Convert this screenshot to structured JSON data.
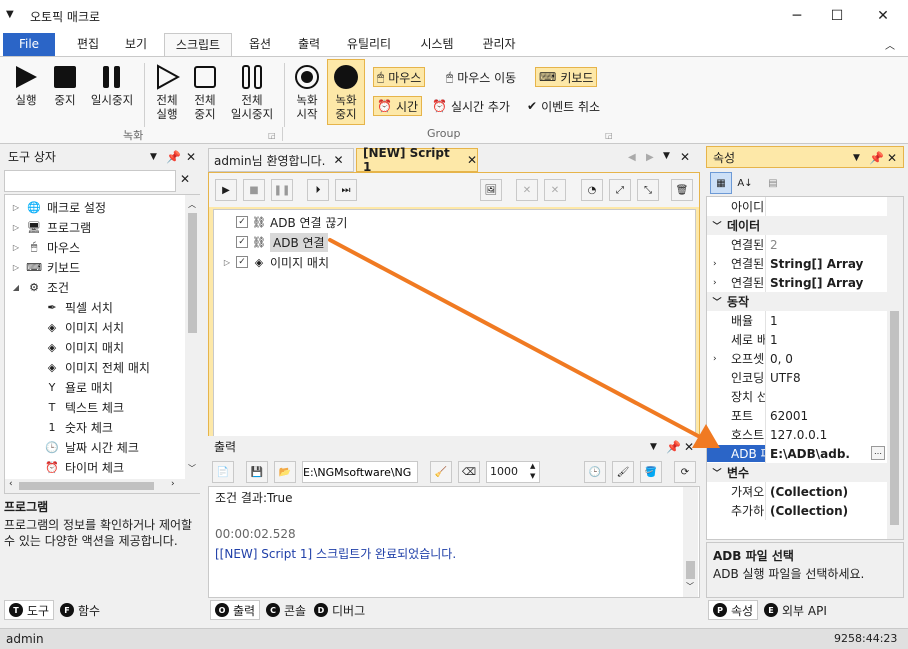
{
  "window": {
    "title": "오토픽 매크로",
    "minimize": "─",
    "maximize": "☐",
    "close": "✕"
  },
  "ribbon_tabs": [
    "File",
    "편집",
    "보기",
    "스크립트",
    "옵션",
    "출력",
    "유틸리티",
    "시스템",
    "관리자"
  ],
  "ribbon": {
    "run": "실행",
    "stop": "중지",
    "pause": "일시중지",
    "run_all": "전체\n실행",
    "stop_all": "전체\n중지",
    "pause_all": "전체\n일시중지",
    "rec_start": "녹화\n시작",
    "rec_stop": "녹화\n중지",
    "mouse": "마우스",
    "mouse_move": "마우스 이동",
    "keyboard": "키보드",
    "time": "시간",
    "realtime_add": "실시간 추가",
    "event_cancel": "이벤트 취소",
    "group_record": "녹화",
    "group_group": "Group"
  },
  "toolbox": {
    "title": "도구 상자",
    "items": [
      {
        "label": "매크로 설정",
        "level": 0,
        "tri": "▷"
      },
      {
        "label": "프로그램",
        "level": 0,
        "tri": "▷"
      },
      {
        "label": "마우스",
        "level": 0,
        "tri": "▷"
      },
      {
        "label": "키보드",
        "level": 0,
        "tri": "▷"
      },
      {
        "label": "조건",
        "level": 0,
        "tri": "◢"
      },
      {
        "label": "픽셀 서치",
        "level": 1
      },
      {
        "label": "이미지 서치",
        "level": 1
      },
      {
        "label": "이미지 매치",
        "level": 1
      },
      {
        "label": "이미지 전체 매치",
        "level": 1
      },
      {
        "label": "욜로 매치",
        "level": 1
      },
      {
        "label": "텍스트 체크",
        "level": 1
      },
      {
        "label": "숫자 체크",
        "level": 1
      },
      {
        "label": "날짜 시간 체크",
        "level": 1
      },
      {
        "label": "타이머 체크",
        "level": 1
      }
    ],
    "desc_title": "프로그램",
    "desc_text": "프로그램의 정보를 확인하거나 제어할 수 있는 다양한 액션을 제공합니다.",
    "tabs": [
      "도구",
      "함수"
    ]
  },
  "doc_tabs": [
    "admin님 환영합니다.",
    "[NEW] Script 1"
  ],
  "script_tree": [
    {
      "label": "ADB 연결 끊기",
      "indent": 1
    },
    {
      "label": "ADB 연결",
      "indent": 1,
      "selected": true
    },
    {
      "label": "이미지 매치",
      "indent": 0
    }
  ],
  "output": {
    "title": "출력",
    "path": "E:\\NGMsoftware\\NG",
    "limit": "1000",
    "lines": [
      "조건 결과:True",
      "",
      "00:00:02.528",
      "[[NEW] Script 1] 스크립트가 완료되었습니다."
    ],
    "tabs": [
      "출력",
      "콘솔",
      "디버그"
    ]
  },
  "properties": {
    "title": "속성",
    "rows": [
      {
        "type": "row",
        "k": "아이디",
        "v": ""
      },
      {
        "type": "cat",
        "k": "데이터"
      },
      {
        "type": "row",
        "k": "연결된 장치",
        "v": "2",
        "gray": true
      },
      {
        "type": "row",
        "k": "연결된 장치",
        "v": "String[] Array",
        "bold": true,
        "exp": true
      },
      {
        "type": "row",
        "k": "연결된 장치",
        "v": "String[] Array",
        "bold": true,
        "exp": true
      },
      {
        "type": "cat",
        "k": "동작"
      },
      {
        "type": "row",
        "k": "배율",
        "v": "1"
      },
      {
        "type": "row",
        "k": "세로 배율",
        "v": "1"
      },
      {
        "type": "row",
        "k": "오프셋",
        "v": "0, 0",
        "exp": true
      },
      {
        "type": "row",
        "k": "인코딩",
        "v": "UTF8"
      },
      {
        "type": "row",
        "k": "장치 선택",
        "v": ""
      },
      {
        "type": "row",
        "k": "포트",
        "v": "62001"
      },
      {
        "type": "row",
        "k": "호스트",
        "v": "127.0.0.1"
      },
      {
        "type": "row",
        "k": "ADB 파일",
        "v": "E:\\ADB\\adb.",
        "bold": true,
        "selected": true
      },
      {
        "type": "cat",
        "k": "변수"
      },
      {
        "type": "row",
        "k": "가져오기",
        "v": "(Collection)",
        "bold": true
      },
      {
        "type": "row",
        "k": "추가하기",
        "v": "(Collection)",
        "bold": true
      }
    ],
    "desc_title": "ADB 파일 선택",
    "desc_text": "ADB 실행 파일을 선택하세요.",
    "tabs": [
      "속성",
      "외부 API"
    ]
  },
  "status": {
    "user": "admin",
    "time": "9258:44:23"
  },
  "colors": {
    "accent": "#2b65c7",
    "arrow": "#f07a22",
    "highlight": "#fde8a8"
  }
}
